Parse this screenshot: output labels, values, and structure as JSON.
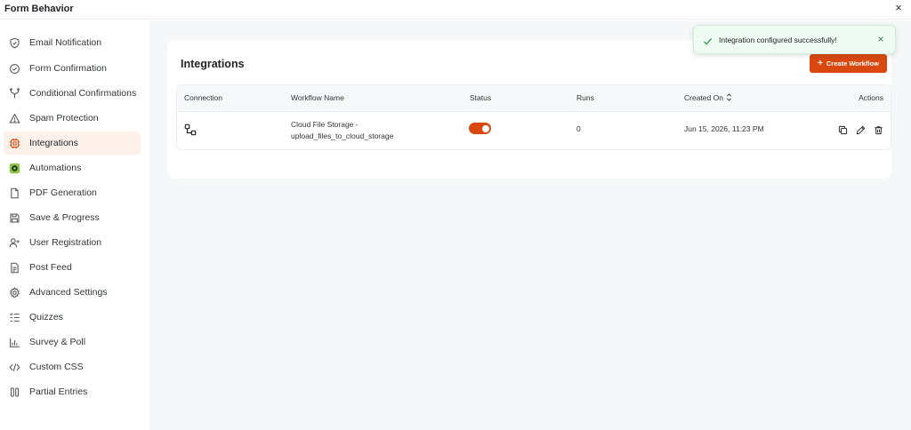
{
  "header": {
    "title": "Form Behavior",
    "close_icon": "×"
  },
  "sidebar": {
    "items": [
      {
        "label": "Email Notification",
        "icon": "shield-icon",
        "active": false
      },
      {
        "label": "Form Confirmation",
        "icon": "check-circle-icon",
        "active": false
      },
      {
        "label": "Conditional Confirmations",
        "icon": "branch-icon",
        "active": false
      },
      {
        "label": "Spam Protection",
        "icon": "warning-icon",
        "active": false
      },
      {
        "label": "Integrations",
        "icon": "chip-icon",
        "active": true
      },
      {
        "label": "Automations",
        "icon": "automation-icon",
        "active": false
      },
      {
        "label": "PDF Generation",
        "icon": "file-icon",
        "active": false
      },
      {
        "label": "Save & Progress",
        "icon": "save-icon",
        "active": false
      },
      {
        "label": "User Registration",
        "icon": "user-plus-icon",
        "active": false
      },
      {
        "label": "Post Feed",
        "icon": "document-icon",
        "active": false
      },
      {
        "label": "Advanced Settings",
        "icon": "gear-icon",
        "active": false
      },
      {
        "label": "Quizzes",
        "icon": "list-icon",
        "active": false
      },
      {
        "label": "Survey & Poll",
        "icon": "bar-chart-icon",
        "active": false
      },
      {
        "label": "Custom CSS",
        "icon": "code-icon",
        "active": false
      },
      {
        "label": "Partial Entries",
        "icon": "columns-icon",
        "active": false
      }
    ]
  },
  "main": {
    "title": "Integrations",
    "create_button": {
      "plus": "+",
      "label": "Create Workflow"
    },
    "table": {
      "columns": [
        "Connection",
        "Workflow Name",
        "Status",
        "Runs",
        "Created On",
        "Actions"
      ],
      "rows": [
        {
          "connection_icon": "connection-icon",
          "workflow_name_line1": "Cloud File Storage -",
          "workflow_name_line2": "upload_files_to_cloud_storage",
          "status_on": true,
          "runs": "0",
          "created_on": "Jun 15, 2026, 11:23 PM"
        }
      ]
    }
  },
  "toast": {
    "message": "Integration configured successfully!",
    "close": "×"
  },
  "colors": {
    "accent": "#d9480f",
    "active_bg": "#fdf1ea",
    "toast_bg": "#effaf2",
    "success": "#2f9e55"
  }
}
